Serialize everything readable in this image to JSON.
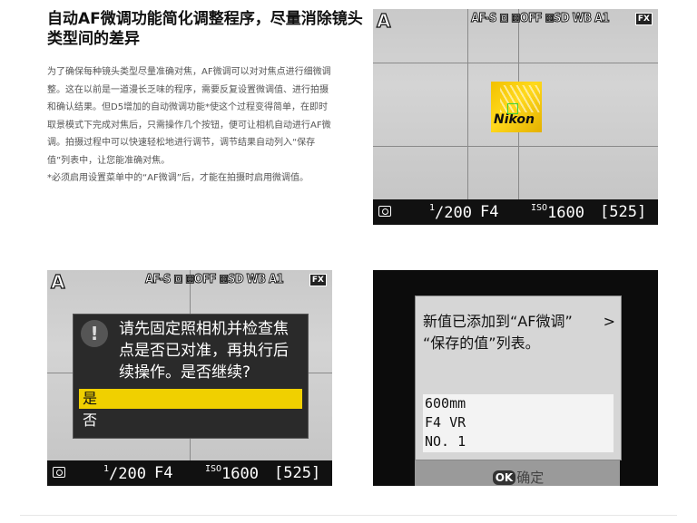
{
  "article": {
    "title_lines": [
      "自动AF微调功能简化调整程序，尽量消除镜头",
      "类型间的差异"
    ],
    "body_lines": [
      "为了确保每种镜头类型尽量准确对焦，AF微调可以对对焦点进行细微调",
      "整。这在以前是一道漫长乏味的程序，需要反复设置微调值、进行拍摄",
      "和确认结果。但D5增加的自动微调功能*使这个过程变得简单，在即时",
      "取景模式下完成对焦后，只需操作几个按钮，便可让相机自动进行AF微",
      "调。拍摄过程中可以快速轻松地进行调节，调节结果自动列入“保存",
      "值”列表中，让您能准确对焦。"
    ],
    "note": "*必须启用设置菜单中的“AF微调”后，才能在拍摄时启用微调值。"
  },
  "camera": {
    "mode": "A",
    "top_info": "AF-S ⊡ ⊠OFF ⊠SD WB A1",
    "format_badge": "FX",
    "shutter_num": "1",
    "shutter_den": "/200",
    "aperture": "F4",
    "iso_label": "ISO",
    "iso_value": "1600",
    "shots_remaining": "[525]",
    "brand": "Nikon"
  },
  "dialog": {
    "message_lines": [
      "请先固定照相机并检查焦",
      "点是否已对准，再执行后",
      "续操作。是否继续?"
    ],
    "options": [
      {
        "label": "是",
        "selected": true
      },
      {
        "label": "否",
        "selected": false
      }
    ]
  },
  "saved_menu": {
    "message_lines": [
      "新值已添加到“AF微调”",
      "“保存的值”列表。"
    ],
    "entries": [
      "600mm",
      "F4 VR",
      "NO. 1"
    ],
    "ok_label": "OK",
    "confirm_label": "确定"
  },
  "colors": {
    "accent_yellow": "#f0d000",
    "af_point_green": "#39d23a"
  }
}
